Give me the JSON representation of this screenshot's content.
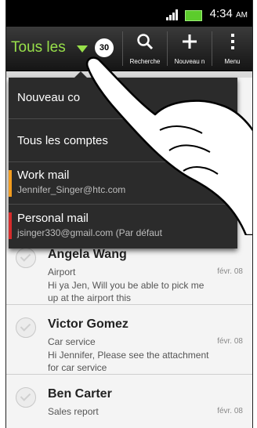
{
  "status": {
    "time": "4:34",
    "ampm": "AM"
  },
  "toolbar": {
    "account_label": "Tous les",
    "unread_count": "30",
    "search_label": "Recherche",
    "new_label": "Nouveau n",
    "menu_label": "Menu"
  },
  "dropdown": {
    "new_account": "Nouveau co",
    "all_accounts": "Tous les comptes",
    "accounts": [
      {
        "name": "Work mail",
        "email": "Jennifer_Singer@htc.com",
        "color": "#f39c1e"
      },
      {
        "name": "Personal mail",
        "email": "jsinger330@gmail.com (Par défaut",
        "color": "#d62b2b"
      }
    ]
  },
  "messages": [
    {
      "sender": "Angela Wang",
      "subject": "Airport",
      "date": "févr. 08",
      "preview": "Hi ya Jen,  Will you be able to pick me up at the airport this"
    },
    {
      "sender": "Victor Gomez",
      "subject": "Car service",
      "date": "févr. 08",
      "preview": "Hi Jennifer, Please see the attachment for car service"
    },
    {
      "sender": "Ben Carter",
      "subject": "Sales report",
      "date": "févr. 08",
      "preview": ""
    }
  ],
  "colors": {
    "accent": "#98e04a",
    "toolbar": "#1f1f1f",
    "menu": "#2b2b2b"
  }
}
